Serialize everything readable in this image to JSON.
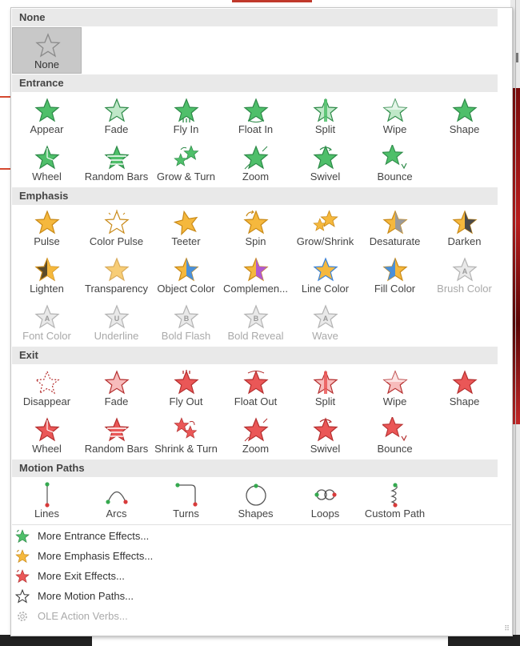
{
  "sections": {
    "none": "None",
    "entrance": "Entrance",
    "emphasis": "Emphasis",
    "exit": "Exit",
    "motion_paths": "Motion Paths"
  },
  "none_tile": {
    "label": "None",
    "icon": "star-outline-icon",
    "selected": true
  },
  "entrance": [
    {
      "label": "Appear",
      "icon": "appear-icon"
    },
    {
      "label": "Fade",
      "icon": "fade-icon"
    },
    {
      "label": "Fly In",
      "icon": "fly-in-icon"
    },
    {
      "label": "Float In",
      "icon": "float-in-icon"
    },
    {
      "label": "Split",
      "icon": "split-icon"
    },
    {
      "label": "Wipe",
      "icon": "wipe-icon"
    },
    {
      "label": "Shape",
      "icon": "shape-icon"
    },
    {
      "label": "Wheel",
      "icon": "wheel-icon"
    },
    {
      "label": "Random Bars",
      "icon": "random-bars-icon"
    },
    {
      "label": "Grow & Turn",
      "icon": "grow-turn-icon"
    },
    {
      "label": "Zoom",
      "icon": "zoom-icon"
    },
    {
      "label": "Swivel",
      "icon": "swivel-icon"
    },
    {
      "label": "Bounce",
      "icon": "bounce-icon"
    }
  ],
  "emphasis": [
    {
      "label": "Pulse",
      "icon": "pulse-icon",
      "disabled": false
    },
    {
      "label": "Color Pulse",
      "icon": "color-pulse-icon",
      "disabled": false
    },
    {
      "label": "Teeter",
      "icon": "teeter-icon",
      "disabled": false
    },
    {
      "label": "Spin",
      "icon": "spin-icon",
      "disabled": false
    },
    {
      "label": "Grow/Shrink",
      "icon": "grow-shrink-icon",
      "disabled": false
    },
    {
      "label": "Desaturate",
      "icon": "desaturate-icon",
      "disabled": false
    },
    {
      "label": "Darken",
      "icon": "darken-icon",
      "disabled": false
    },
    {
      "label": "Lighten",
      "icon": "lighten-icon",
      "disabled": false
    },
    {
      "label": "Transparency",
      "icon": "transparency-icon",
      "disabled": false
    },
    {
      "label": "Object Color",
      "icon": "object-color-icon",
      "disabled": false
    },
    {
      "label": "Complemen...",
      "icon": "complementary-color-icon",
      "disabled": false
    },
    {
      "label": "Line Color",
      "icon": "line-color-icon",
      "disabled": false
    },
    {
      "label": "Fill Color",
      "icon": "fill-color-icon",
      "disabled": false
    },
    {
      "label": "Brush Color",
      "icon": "brush-color-icon",
      "disabled": true
    },
    {
      "label": "Font Color",
      "icon": "font-color-icon",
      "disabled": true
    },
    {
      "label": "Underline",
      "icon": "underline-icon",
      "disabled": true
    },
    {
      "label": "Bold Flash",
      "icon": "bold-flash-icon",
      "disabled": true
    },
    {
      "label": "Bold Reveal",
      "icon": "bold-reveal-icon",
      "disabled": true
    },
    {
      "label": "Wave",
      "icon": "wave-icon",
      "disabled": true
    }
  ],
  "exit": [
    {
      "label": "Disappear",
      "icon": "disappear-icon"
    },
    {
      "label": "Fade",
      "icon": "fade-out-icon"
    },
    {
      "label": "Fly Out",
      "icon": "fly-out-icon"
    },
    {
      "label": "Float Out",
      "icon": "float-out-icon"
    },
    {
      "label": "Split",
      "icon": "split-out-icon"
    },
    {
      "label": "Wipe",
      "icon": "wipe-out-icon"
    },
    {
      "label": "Shape",
      "icon": "shape-out-icon"
    },
    {
      "label": "Wheel",
      "icon": "wheel-out-icon"
    },
    {
      "label": "Random Bars",
      "icon": "random-bars-out-icon"
    },
    {
      "label": "Shrink & Turn",
      "icon": "shrink-turn-icon"
    },
    {
      "label": "Zoom",
      "icon": "zoom-out-icon"
    },
    {
      "label": "Swivel",
      "icon": "swivel-out-icon"
    },
    {
      "label": "Bounce",
      "icon": "bounce-out-icon"
    }
  ],
  "motion_paths": [
    {
      "label": "Lines",
      "icon": "lines-path-icon"
    },
    {
      "label": "Arcs",
      "icon": "arcs-path-icon"
    },
    {
      "label": "Turns",
      "icon": "turns-path-icon"
    },
    {
      "label": "Shapes",
      "icon": "shapes-path-icon"
    },
    {
      "label": "Loops",
      "icon": "loops-path-icon"
    },
    {
      "label": "Custom Path",
      "icon": "custom-path-icon"
    }
  ],
  "menu": [
    {
      "label": "More Entrance Effects...",
      "icon": "more-entrance-effects-icon",
      "disabled": false
    },
    {
      "label": "More Emphasis Effects...",
      "icon": "more-emphasis-effects-icon",
      "disabled": false
    },
    {
      "label": "More Exit Effects...",
      "icon": "more-exit-effects-icon",
      "disabled": false
    },
    {
      "label": "More Motion Paths...",
      "icon": "more-motion-paths-icon",
      "disabled": false
    },
    {
      "label": "OLE Action Verbs...",
      "icon": "ole-action-verbs-icon",
      "disabled": true
    }
  ],
  "colors": {
    "entrance": "#3aa65a",
    "emphasis": "#f0b030",
    "exit": "#e04a4a",
    "disabled": "#b5b5b5",
    "header_bg": "#e9e9e9",
    "selected_bg": "#c8c8c8"
  }
}
